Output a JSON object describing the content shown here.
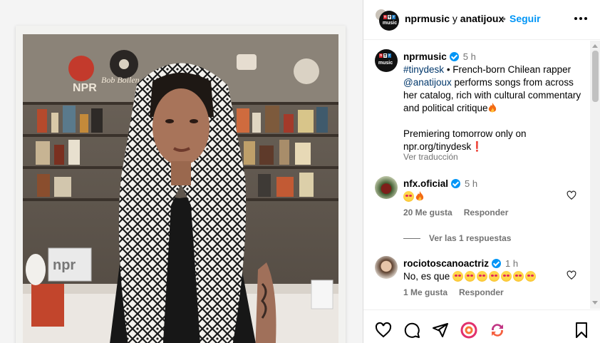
{
  "post": {
    "header": {
      "author": "nprmusic",
      "connector": "y",
      "collaborator": "anatijoux",
      "separator": "•",
      "follow_label": "Seguir"
    },
    "avatar_logo": {
      "letters": [
        "n",
        "p",
        "r"
      ],
      "sub": "music",
      "colors": [
        "#d8232a",
        "#111111",
        "#237bbd"
      ]
    },
    "caption": {
      "username": "nprmusic",
      "time": "5 h",
      "hashtag": "#tinydesk",
      "text1": "• French-born Chilean rapper",
      "mention": "@anatijoux",
      "text2": "performs songs from across her catalog, rich with cultural commentary and political critique",
      "premiere": "Premiering tomorrow only on npr.org/tinydesk",
      "translate": "Ver traducción"
    },
    "comments": [
      {
        "username": "nfx.oficial",
        "time": "5 h",
        "likes": "20 Me gusta",
        "reply_label": "Responder"
      },
      {
        "username": "rociotoscanoactriz",
        "time": "1 h",
        "text": "No, es que",
        "likes": "1 Me gusta",
        "reply_label": "Responder"
      }
    ],
    "view_replies": "Ver las 1 respuestas",
    "photo": {
      "sign_text": "npr",
      "wall_text": "Bob Boilen"
    }
  },
  "colors": {
    "accent": "#0095f6",
    "muted": "#737373",
    "link": "#00376b"
  }
}
